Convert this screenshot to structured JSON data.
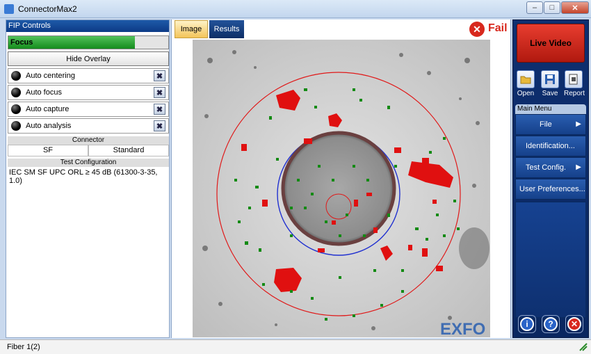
{
  "window": {
    "title": "ConnectorMax2"
  },
  "fip": {
    "header": "FIP Controls",
    "focus_label": "Focus",
    "focus_level": 0.79,
    "hide_overlay": "Hide Overlay",
    "options": [
      "Auto centering",
      "Auto focus",
      "Auto capture",
      "Auto analysis"
    ],
    "connector_header": "Connector",
    "connector_values": [
      "SF",
      "Standard"
    ],
    "test_config_header": "Test Configuration",
    "test_config_value": "IEC SM SF UPC ORL ≥ 45 dB (61300-3-35, 1.0)"
  },
  "tabs": [
    "Image",
    "Results"
  ],
  "result": {
    "label": "Fail",
    "color": "#d8281d"
  },
  "image": {
    "watermark": "EXFO"
  },
  "right": {
    "live_video": "Live Video",
    "tools": [
      "Open",
      "Save",
      "Report"
    ],
    "main_menu_header": "Main Menu",
    "menu_items": [
      {
        "label": "File",
        "arrow": "▶"
      },
      {
        "label": "Identification...",
        "arrow": ""
      },
      {
        "label": "Test Config.",
        "arrow": "▶"
      },
      {
        "label": "User Preferences...",
        "arrow": ""
      }
    ]
  },
  "status": {
    "text": "Fiber 1(2)"
  },
  "icons": [
    "app-icon",
    "minimize-icon",
    "maximize-icon",
    "close-icon",
    "fail-icon",
    "open-icon",
    "save-icon",
    "report-icon",
    "info-icon",
    "help-icon",
    "exit-icon",
    "resize-grip-icon"
  ]
}
